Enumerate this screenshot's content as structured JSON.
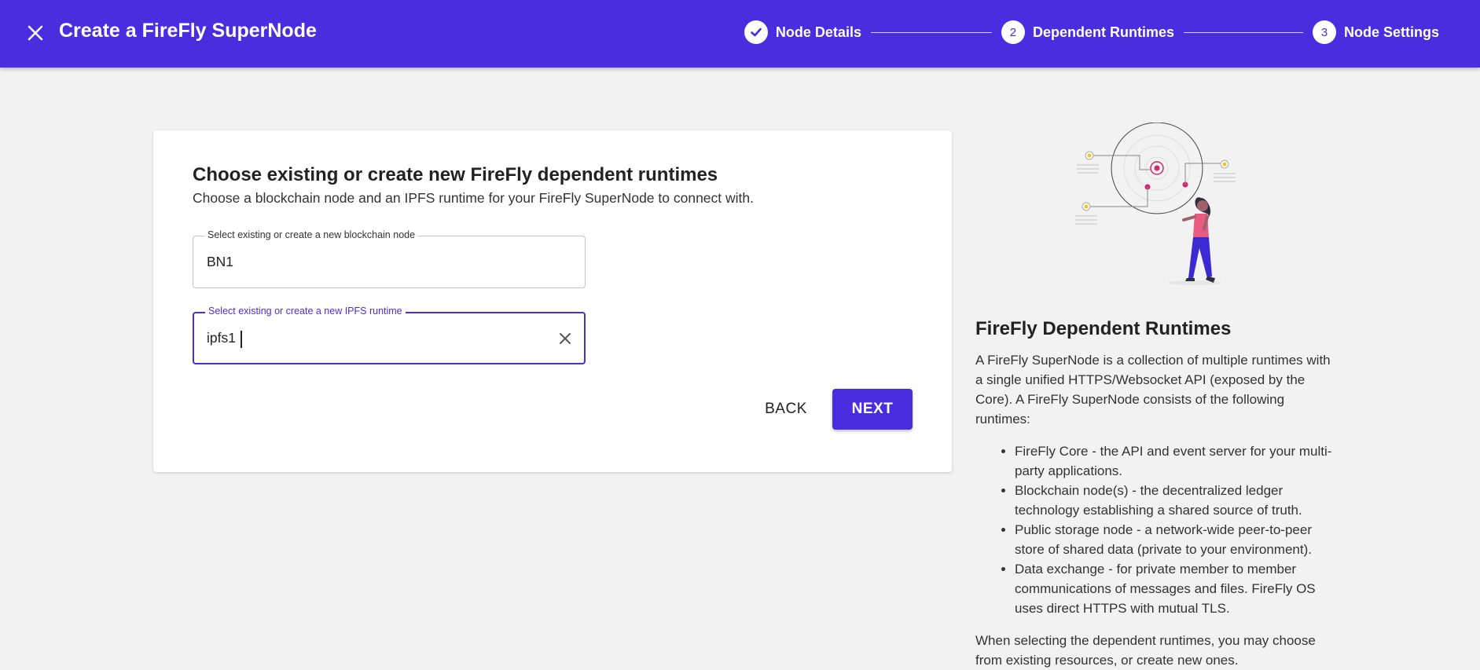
{
  "header": {
    "title": "Create a FireFly SuperNode",
    "steps": [
      {
        "number": "",
        "label": "Node Details",
        "status": "completed"
      },
      {
        "number": "2",
        "label": "Dependent Runtimes",
        "status": "active"
      },
      {
        "number": "3",
        "label": "Node Settings",
        "status": "upcoming"
      }
    ]
  },
  "form": {
    "title": "Choose existing or create new FireFly dependent runtimes",
    "subtitle": "Choose a blockchain node and an IPFS runtime for your FireFly SuperNode to connect with.",
    "blockchain_field": {
      "label": "Select existing or create a new blockchain node",
      "value": "BN1"
    },
    "ipfs_field": {
      "label": "Select existing or create a new IPFS runtime",
      "value": "ipfs1"
    },
    "back_label": "BACK",
    "next_label": "NEXT"
  },
  "info": {
    "title": "FireFly Dependent Runtimes",
    "intro": "A FireFly SuperNode is a collection of multiple runtimes with a single unified HTTPS/Websocket API (exposed by the Core). A FireFly SuperNode consists of the following runtimes:",
    "items": [
      "FireFly Core - the API and event server for your multi-party applications.",
      "Blockchain node(s) - the decentralized ledger technology establishing a shared source of truth.",
      "Public storage node - a network-wide peer-to-peer store of shared data (private to your environment).",
      "Data exchange - for private member to member communications of messages and files. FireFly OS uses direct HTTPS with mutual TLS."
    ],
    "outro": "When selecting the dependent runtimes, you may choose from existing resources, or create new ones."
  },
  "colors": {
    "primary": "#4a2ddf",
    "background": "#f2f2f2",
    "illustration_accent": "#d6256b",
    "illustration_dot": "#f5c518"
  },
  "icons": {
    "close": "close-icon",
    "check": "check-icon",
    "clear": "clear-icon"
  }
}
